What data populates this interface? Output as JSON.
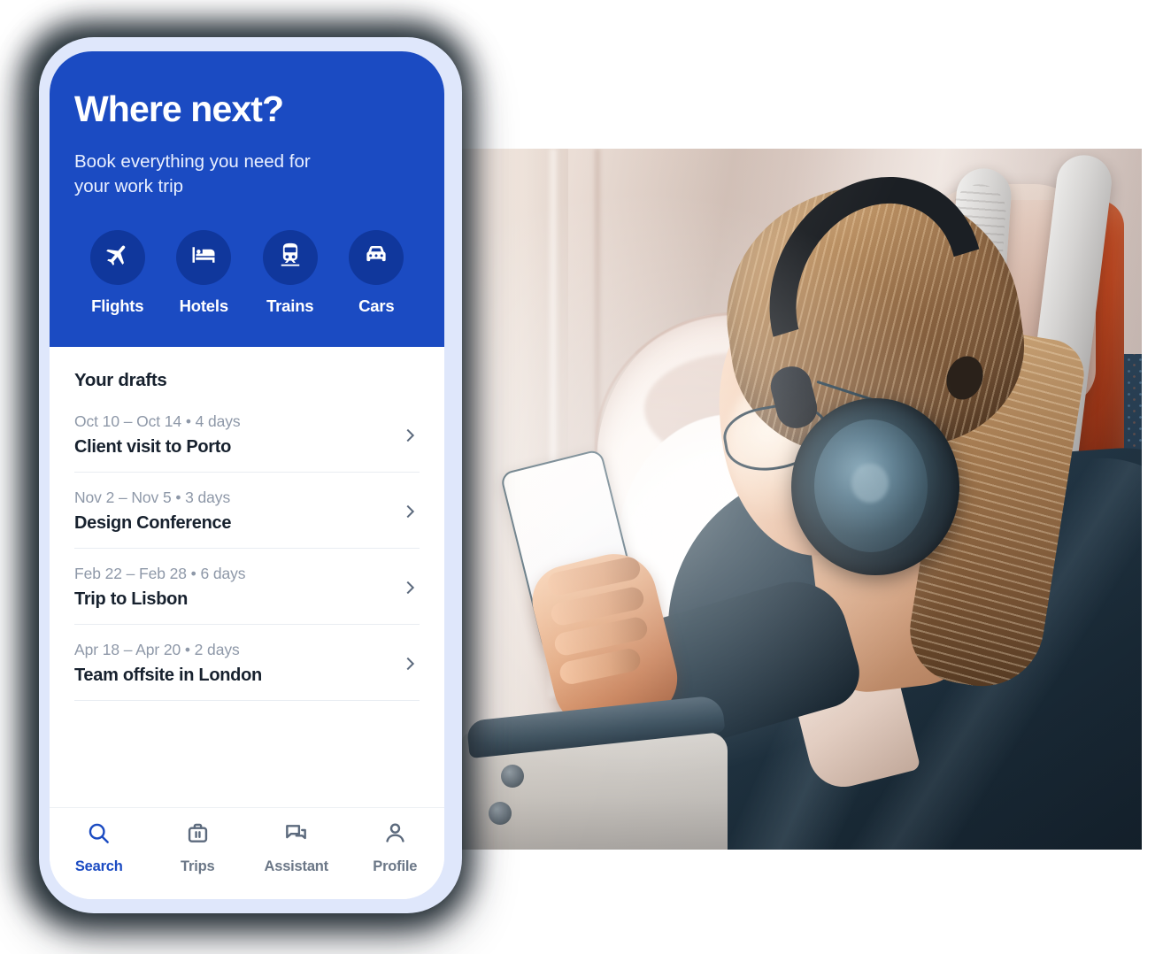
{
  "app": {
    "accent_blue": "#1b4bc2",
    "icon_circle_blue": "#10379c",
    "phone_frame_color": "#dfe7fb",
    "text_dark": "#17212e",
    "text_muted": "#8e98a8"
  },
  "hero": {
    "title": "Where next?",
    "subtitle": "Book everything you need for your work trip",
    "categories": [
      {
        "label": "Flights",
        "icon": "airplane-icon"
      },
      {
        "label": "Hotels",
        "icon": "bed-icon"
      },
      {
        "label": "Trains",
        "icon": "train-icon"
      },
      {
        "label": "Cars",
        "icon": "car-icon"
      }
    ]
  },
  "drafts": {
    "section_title": "Your drafts",
    "items": [
      {
        "dates": "Oct 10 – Oct 14 • 4 days",
        "name": "Client visit to Porto"
      },
      {
        "dates": "Nov 2 – Nov 5 • 3 days",
        "name": "Design Conference"
      },
      {
        "dates": "Feb 22 – Feb 28 • 6 days",
        "name": "Trip to Lisbon"
      },
      {
        "dates": "Apr 18 – Apr 20 • 2 days",
        "name": "Team offsite in London"
      }
    ]
  },
  "tabbar": {
    "tabs": [
      {
        "label": "Search",
        "icon": "search-icon",
        "active": true
      },
      {
        "label": "Trips",
        "icon": "suitcase-icon",
        "active": false
      },
      {
        "label": "Assistant",
        "icon": "chat-bubbles-icon",
        "active": false
      },
      {
        "label": "Profile",
        "icon": "person-icon",
        "active": false
      }
    ]
  },
  "photo": {
    "alt": "Woman with headphones and glasses in an airplane window seat looking at her phone"
  }
}
